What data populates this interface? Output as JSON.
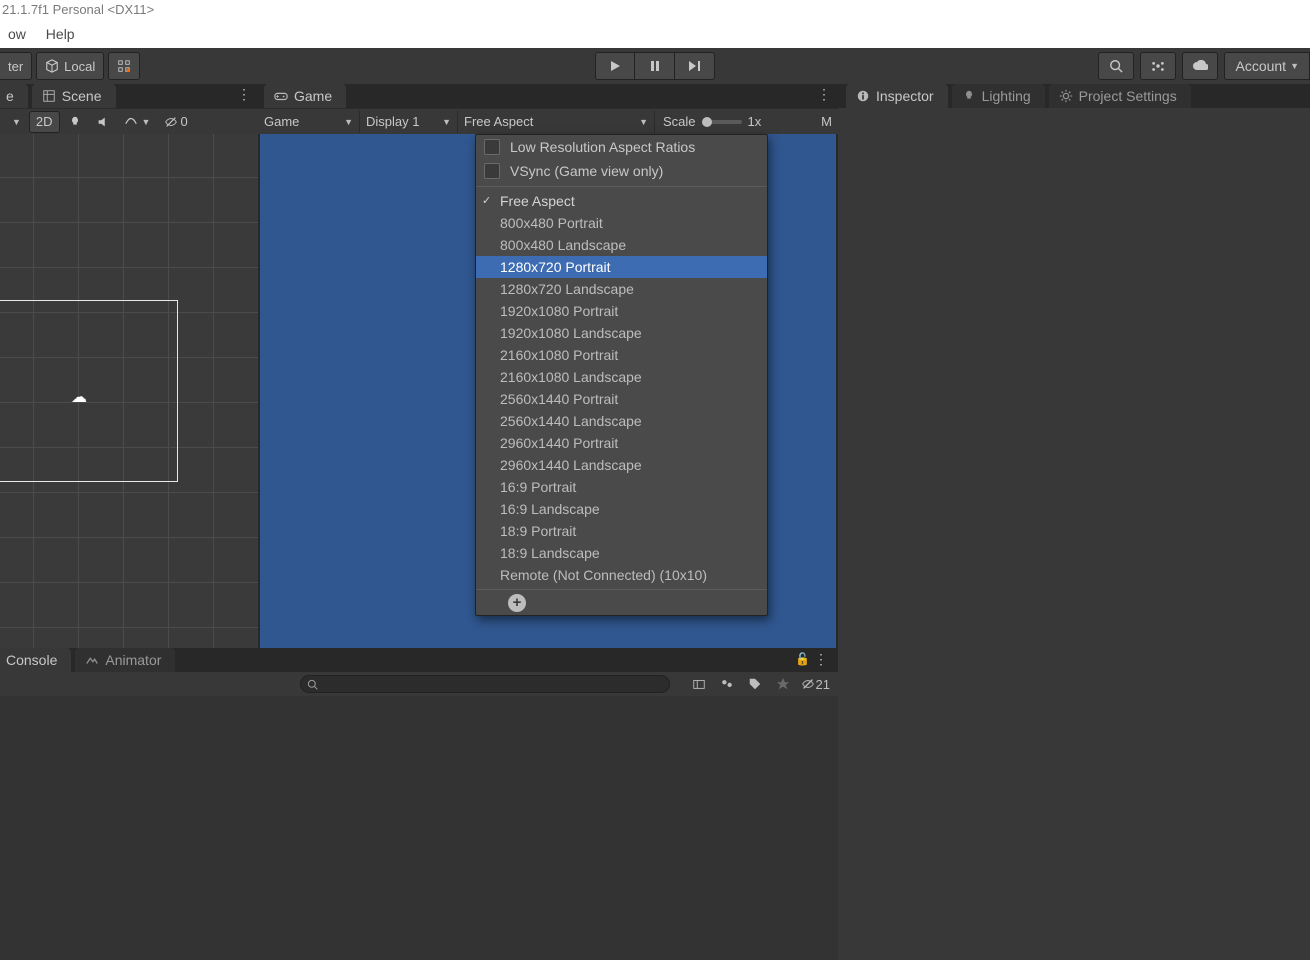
{
  "title_strip": "21.1.7f1 Personal <DX11>",
  "menu": {
    "window": "ow",
    "help": "Help"
  },
  "main_toolbar": {
    "center_btn": "ter",
    "local_btn": "Local",
    "account": "Account"
  },
  "scene_panel": {
    "tab_left": "e",
    "tab_scene": "Scene",
    "toolbar": {
      "mode2d": "2D",
      "hidden_count": "0"
    }
  },
  "game_panel": {
    "tab": "Game",
    "dd_game": "Game",
    "dd_display": "Display 1",
    "dd_aspect": "Free Aspect",
    "scale_label": "Scale",
    "scale_value": "1x",
    "trailing": "M"
  },
  "aspect_popup": {
    "low_res": "Low Resolution Aspect Ratios",
    "vsync": "VSync (Game view only)",
    "options": [
      "Free Aspect",
      "800x480 Portrait",
      "800x480 Landscape",
      "1280x720 Portrait",
      "1280x720 Landscape",
      "1920x1080 Portrait",
      "1920x1080 Landscape",
      "2160x1080 Portrait",
      "2160x1080 Landscape",
      "2560x1440 Portrait",
      "2560x1440 Landscape",
      "2960x1440 Portrait",
      "2960x1440 Landscape",
      "16:9 Portrait",
      "16:9 Landscape",
      "18:9 Portrait",
      "18:9 Landscape",
      "Remote (Not Connected) (10x10)"
    ],
    "current_index": 0,
    "highlight_index": 3
  },
  "right_panel": {
    "inspector": "Inspector",
    "lighting": "Lighting",
    "project_settings": "Project Settings"
  },
  "bottom_panel": {
    "console": "Console",
    "animator": "Animator",
    "search_placeholder": "",
    "hidden_badge": "21"
  }
}
